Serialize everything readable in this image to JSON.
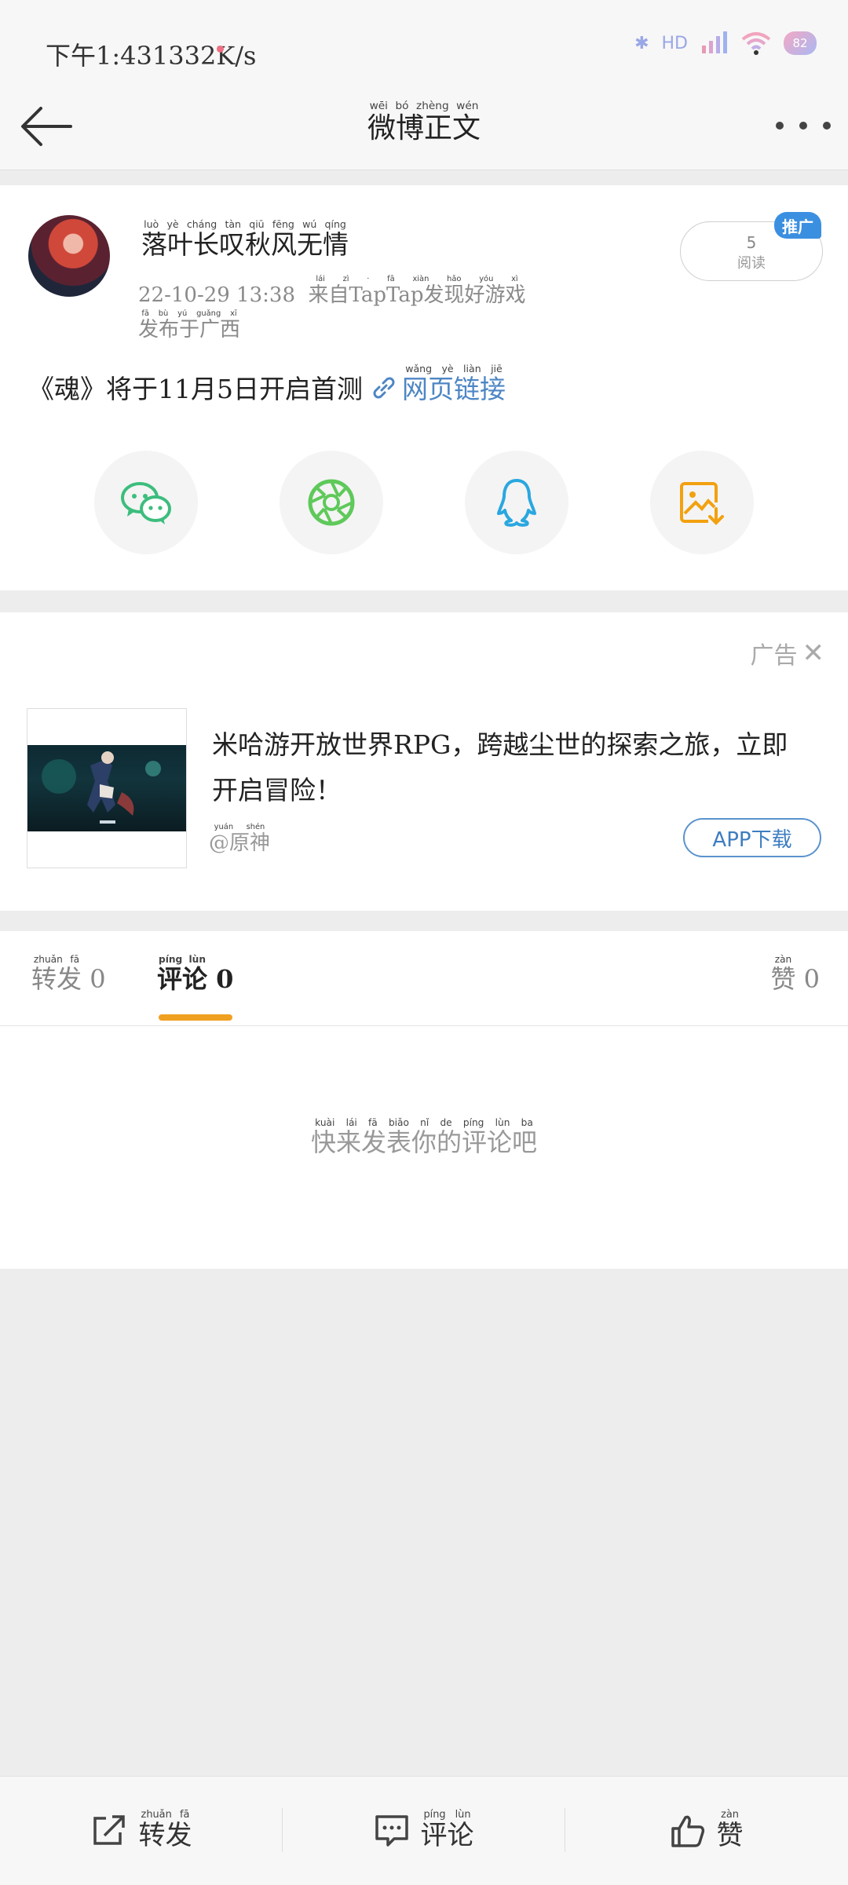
{
  "status_bar": {
    "time": "下午1:43",
    "speed": "1332K/s",
    "bluetooth": "✱",
    "hd": "HD",
    "battery": "82"
  },
  "nav": {
    "title": "微博正文",
    "title_pinyin": [
      "wēi",
      "bó",
      "zhèng",
      "wén"
    ]
  },
  "post": {
    "author": "落叶长叹秋风无情",
    "author_pinyin": [
      "luò",
      "yè",
      "cháng",
      "tàn",
      "qiū",
      "fēng",
      "wú",
      "qíng"
    ],
    "timestamp": "22-10-29 13:38",
    "source": "来自TapTap发现好游戏",
    "source_pinyin_part": [
      "lái",
      "zì"
    ],
    "source_pinyin_tail": [
      "fā",
      "xiàn",
      "hǎo",
      "yóu",
      "xì"
    ],
    "sub": "发布于广西",
    "sub_pinyin": [
      "fā",
      "bù",
      "yú",
      "guǎng",
      "xī"
    ],
    "read_count": "5",
    "read_label": "阅读",
    "promo_tag": "推广",
    "body_text": "《魂》将于11月5日开启首测",
    "link_text": "网页链接",
    "link_pinyin": [
      "wǎng",
      "yè",
      "liàn",
      "jiē"
    ]
  },
  "share": {
    "items": [
      {
        "name": "wechat",
        "color": "#3dbd7d"
      },
      {
        "name": "moments",
        "color": "#5fc95a"
      },
      {
        "name": "qq",
        "color": "#2aa7e0"
      },
      {
        "name": "save-image",
        "color": "#f2a10f"
      }
    ]
  },
  "ad": {
    "label": "广告",
    "close": "✕",
    "text": "米哈游开放世界RPG，跨越尘世的探索之旅，立即开启冒险！",
    "source": "@原神",
    "source_pinyin": [
      "yuán",
      "shén"
    ],
    "download_label": "APP下载"
  },
  "tabs": {
    "repost_label": "转发",
    "repost_count": "0",
    "comment_label": "评论",
    "comment_count": "0",
    "like_label": "赞",
    "like_count": "0",
    "empty_text": "快来发表你的评论吧"
  },
  "bottom_bar": {
    "repost_label": "转发",
    "comment_label": "评论",
    "like_label": "赞"
  },
  "colors": {
    "accent": "#f0a020",
    "link": "#4d86c4",
    "promo": "#3b8fe0"
  }
}
